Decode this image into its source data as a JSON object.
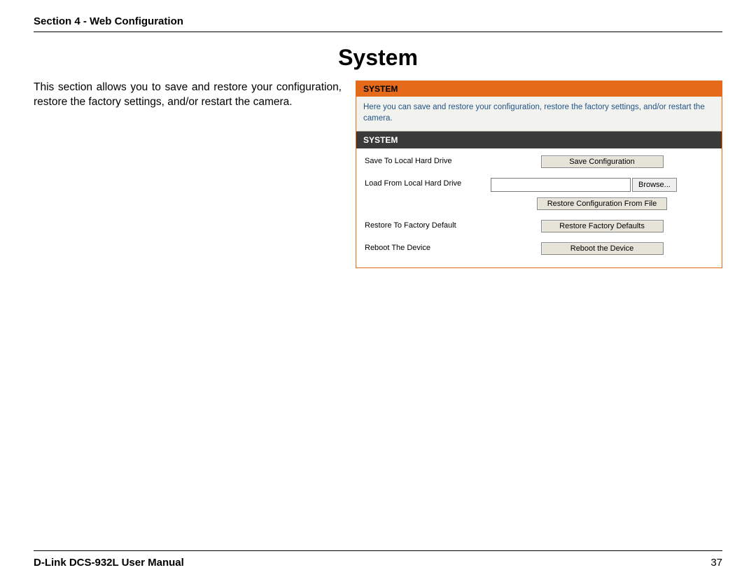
{
  "header": {
    "section": "Section 4 - Web Configuration"
  },
  "title": "System",
  "description": "This section allows you to save and restore your configuration, restore the factory settings, and/or restart the camera.",
  "panel": {
    "header_orange": "SYSTEM",
    "intro": "Here you can save and restore your configuration, restore the factory settings, and/or restart the camera.",
    "header_dark": "SYSTEM",
    "rows": {
      "save": {
        "label": "Save To Local Hard Drive",
        "button": "Save Configuration"
      },
      "load": {
        "label": "Load From Local Hard Drive",
        "browse": "Browse...",
        "button": "Restore Configuration From File"
      },
      "restore": {
        "label": "Restore To Factory Default",
        "button": "Restore Factory Defaults"
      },
      "reboot": {
        "label": "Reboot The Device",
        "button": "Reboot the Device"
      }
    }
  },
  "footer": {
    "manual": "D-Link DCS-932L User Manual",
    "page": "37"
  }
}
